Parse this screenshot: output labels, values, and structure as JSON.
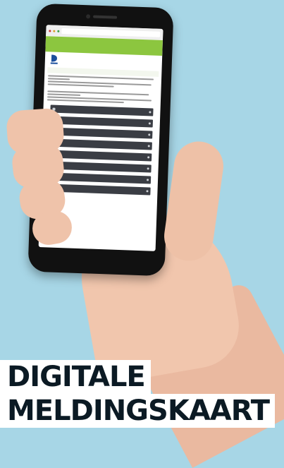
{
  "headline": {
    "line1": "DIGITALE",
    "line2": "MELDINGSKAART"
  },
  "phone_screen": {
    "menu_items": [
      {
        "icon": "document-icon"
      },
      {
        "icon": "shield-icon"
      },
      {
        "icon": "flag-icon"
      },
      {
        "icon": "chat-icon"
      },
      {
        "icon": "gear-icon"
      },
      {
        "icon": "home-icon"
      },
      {
        "icon": "user-icon"
      },
      {
        "icon": "list-icon"
      }
    ]
  },
  "colors": {
    "background": "#a7d6e6",
    "accent": "#8cc63f",
    "menu": "#3a3d44",
    "headline_text": "#0b1a24"
  }
}
